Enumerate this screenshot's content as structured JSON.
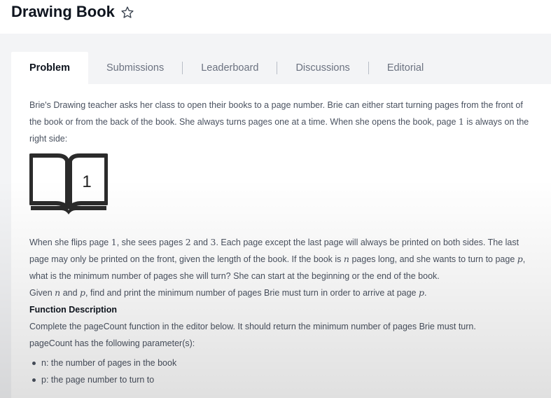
{
  "page": {
    "title": "Drawing Book"
  },
  "tabs": [
    {
      "label": "Problem"
    },
    {
      "label": "Submissions"
    },
    {
      "label": "Leaderboard"
    },
    {
      "label": "Discussions"
    },
    {
      "label": "Editorial"
    }
  ],
  "icons": {
    "favorite": "star-outline-icon",
    "illustration": "open-book-icon"
  },
  "problem": {
    "intro": "Brie's Drawing teacher asks her class to open their books to a page number. Brie can either start turning pages from the front of the book or from the back of the book. She always turns pages one at a time. When she opens the book, page",
    "intro_num": "1",
    "intro_end": "is always on the right side:",
    "book_page_number": "1",
    "p2": {
      "a": "When she flips page",
      "n1": "1",
      "b": ", she sees pages",
      "n2": "2",
      "c": "and",
      "n3": "3",
      "d": ". Each page except the last page will always be printed on both sides. The last page may only be printed on the front, given the length of the book. If the book is",
      "var_n": "n",
      "e": "pages long, and she wants to turn to page",
      "var_p": "p",
      "f": ", what is the minimum number of pages she will turn? She can start at the beginning or the end of the book."
    },
    "p3": {
      "a": "Given",
      "var_n": "n",
      "b": "and",
      "var_p": "p",
      "c": ", find and print the minimum number of pages Brie must turn in order to arrive at page",
      "var_p2": "p",
      "d": "."
    },
    "function_heading": "Function Description",
    "function_text": "Complete the pageCount function in the editor below. It should return the minimum number of pages Brie must turn.",
    "params_heading": "pageCount has the following parameter(s):",
    "params": [
      "n: the number of pages in the book",
      "p: the page number to turn to"
    ]
  }
}
